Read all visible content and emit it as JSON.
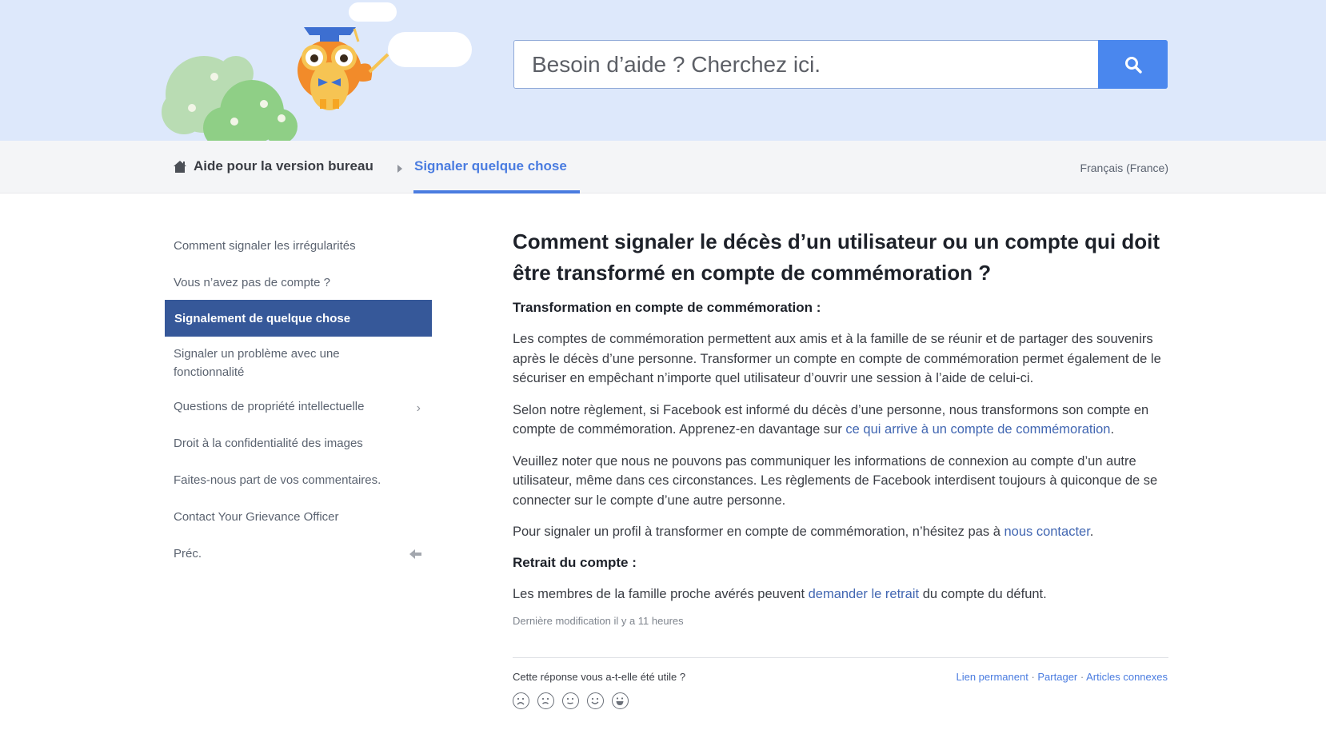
{
  "search": {
    "placeholder": "Besoin d’aide ? Cherchez ici."
  },
  "breadcrumb": {
    "home_label": "Aide pour la version bureau",
    "current_label": "Signaler quelque chose"
  },
  "language": "Français (France)",
  "sidebar": {
    "items": [
      {
        "label": "Comment signaler les irrégularités"
      },
      {
        "label": "Vous n’avez pas de compte ?"
      },
      {
        "label": "Signalement de quelque chose",
        "active": true
      },
      {
        "label": "Signaler un problème avec une fonctionnalité"
      },
      {
        "label": "Questions de propriété intellectuelle",
        "has_submenu": true
      },
      {
        "label": "Droit à la confidentialité des images"
      },
      {
        "label": "Faites-nous part de vos commentaires."
      },
      {
        "label": "Contact Your Grievance Officer"
      },
      {
        "label": "Préc."
      }
    ]
  },
  "article": {
    "title": "Comment signaler le décès d’un utilisateur ou un compte qui doit être transformé en compte de commémoration ?",
    "section1_heading": "Transformation en compte de commémoration :",
    "p1": "Les comptes de commémoration permettent aux amis et à la famille de se réunir et de partager des souvenirs après le décès d’une personne. Transformer un compte en compte de commémoration permet également de le sécuriser en empêchant n’importe quel utilisateur d’ouvrir une session à l’aide de celui-ci.",
    "p2_text": "Selon notre règlement, si Facebook est informé du décès d’une personne, nous transformons son compte en compte de commémoration. Apprenez-en davantage sur ",
    "p2_link": "ce qui arrive à un compte de commémoration",
    "p2_end": ".",
    "p3": "Veuillez noter que nous ne pouvons pas communiquer les informations de connexion au compte d’un autre utilisateur, même dans ces circonstances. Les règlements de Facebook interdisent toujours à quiconque de se connecter sur le compte d’une autre personne.",
    "p4_text": "Pour signaler un profil à transformer en compte de commémoration, n’hésitez pas à ",
    "p4_link": "nous contacter",
    "p4_end": ".",
    "section2_heading": "Retrait du compte :",
    "p5_text": "Les membres de la famille proche avérés peuvent ",
    "p5_link": "demander le retrait",
    "p5_end": " du compte du défunt.",
    "updated": "Dernière modification il y a 11 heures"
  },
  "feedback": {
    "question": "Cette réponse vous a-t-elle été utile ?",
    "faces": [
      "very-sad-face-icon",
      "sad-face-icon",
      "neutral-face-icon",
      "smile-face-icon",
      "big-smile-face-icon"
    ]
  },
  "footer_links": {
    "permalink": "Lien permanent",
    "share": "Partager",
    "related": "Articles connexes",
    "separator": " · "
  },
  "colors": {
    "hero_bg": "#dde8fb",
    "accent": "#4a7ce0",
    "active_sidebar": "#365899",
    "search_button": "#4a87ee"
  }
}
